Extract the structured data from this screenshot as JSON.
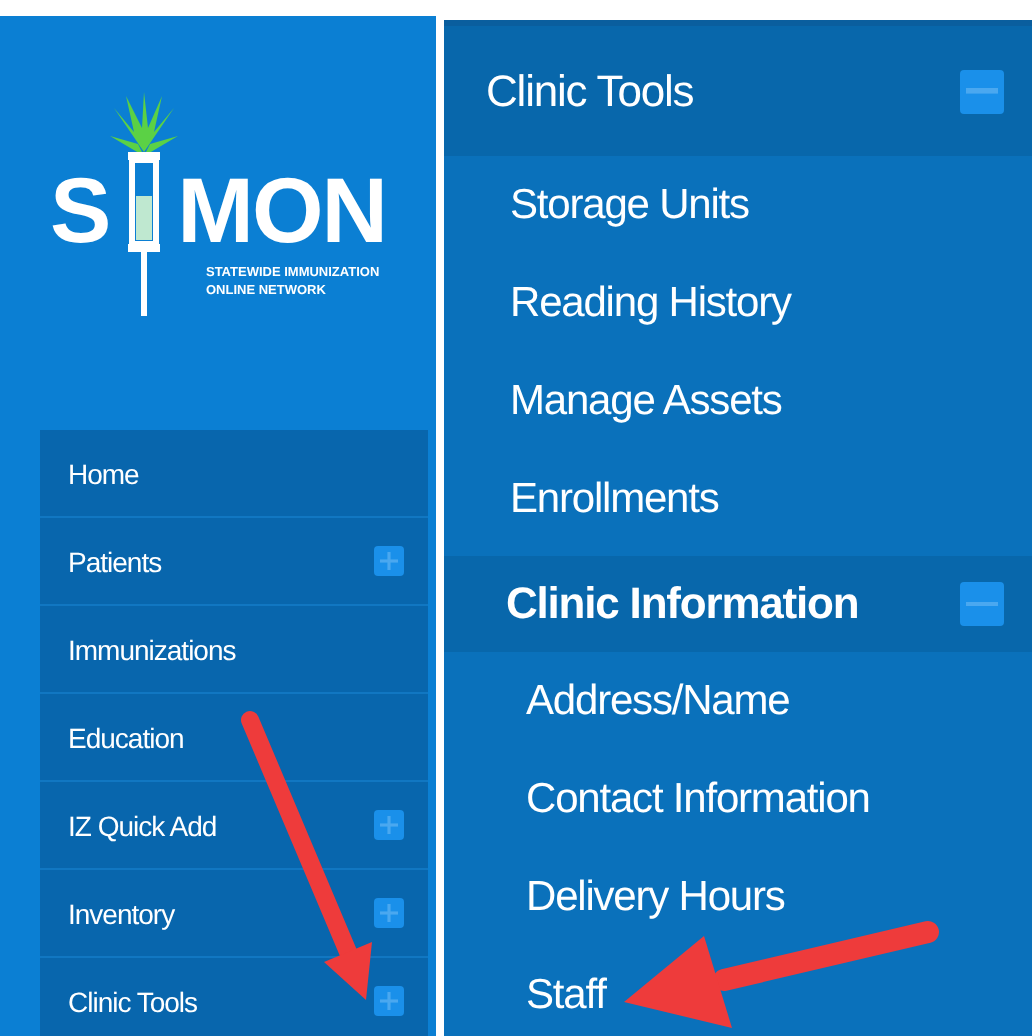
{
  "logo": {
    "letter_left": "S",
    "letters_right": "MON",
    "tagline_lines": [
      "STATEWIDE IMMUNIZATION",
      "ONLINE NETWORK"
    ]
  },
  "sidebar": {
    "items": [
      {
        "label": "Home",
        "kind": "link"
      },
      {
        "label": "Patients",
        "kind": "group",
        "expanded": false
      },
      {
        "label": "Immunizations",
        "kind": "link"
      },
      {
        "label": "Education",
        "kind": "link"
      },
      {
        "label": "IZ Quick Add",
        "kind": "group",
        "expanded": false
      },
      {
        "label": "Inventory",
        "kind": "group",
        "expanded": false
      },
      {
        "label": "Clinic Tools",
        "kind": "group",
        "expanded": false
      }
    ]
  },
  "submenu": {
    "label": "Clinic Tools",
    "expanded": true,
    "items": [
      {
        "label": "Storage Units",
        "kind": "link"
      },
      {
        "label": "Reading History",
        "kind": "link"
      },
      {
        "label": "Manage Assets",
        "kind": "link"
      },
      {
        "label": "Enrollments",
        "kind": "link"
      },
      {
        "label": "Clinic Information",
        "kind": "group",
        "expanded": true,
        "children": [
          {
            "label": "Address/Name",
            "kind": "link"
          },
          {
            "label": "Contact Information",
            "kind": "link"
          },
          {
            "label": "Delivery Hours",
            "kind": "link"
          },
          {
            "label": "Staff",
            "kind": "link"
          }
        ]
      }
    ]
  }
}
